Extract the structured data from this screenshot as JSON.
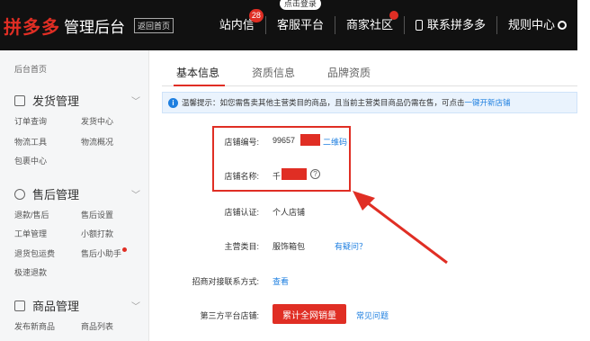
{
  "header": {
    "brand": "拼多多",
    "title": "管理后台",
    "home_link": "返回首页",
    "nav": [
      {
        "label": "站内信",
        "badge": "28"
      },
      {
        "label": "客服平台",
        "bubble": "点击登录"
      },
      {
        "label": "商家社区"
      },
      {
        "label": "联系拼多多"
      },
      {
        "label": "规则中心"
      }
    ]
  },
  "sidebar": {
    "home": "后台首页",
    "sections": [
      {
        "title": "发货管理",
        "links": [
          "订单查询",
          "发货中心",
          "物流工具",
          "物流概况",
          "包裹中心"
        ]
      },
      {
        "title": "售后管理",
        "links": [
          "退款/售后",
          "售后设置",
          "工单管理",
          "小额打款",
          "退货包运费",
          "售后小助手",
          "极速退款"
        ]
      },
      {
        "title": "商品管理",
        "links": [
          "发布新商品",
          "商品列表"
        ]
      }
    ]
  },
  "tabs": [
    "基本信息",
    "资质信息",
    "品牌资质"
  ],
  "tip": {
    "icon": "i",
    "text": "温馨提示：如您需售卖其他主营类目的商品，且当前主营类目商品仍需在售，可点击",
    "link": "一键开新店铺"
  },
  "form": {
    "store_id": {
      "label": "店铺编号:",
      "value": "99657",
      "link": "二维码"
    },
    "store_name": {
      "label": "店铺名称:",
      "value": "千"
    },
    "certification": {
      "label": "店铺认证:",
      "value": "个人店铺"
    },
    "category": {
      "label": "主营类目:",
      "value": "服饰箱包",
      "link": "有疑问？"
    },
    "contact": {
      "label": "招商对接联系方式:",
      "link": "查看"
    },
    "third_party": {
      "label": "第三方平台店铺:",
      "button": "累计全网销量",
      "link": "常见问题"
    }
  },
  "colors": {
    "accent": "#e02e24",
    "link": "#1e7fe0",
    "topbar": "#111111"
  }
}
